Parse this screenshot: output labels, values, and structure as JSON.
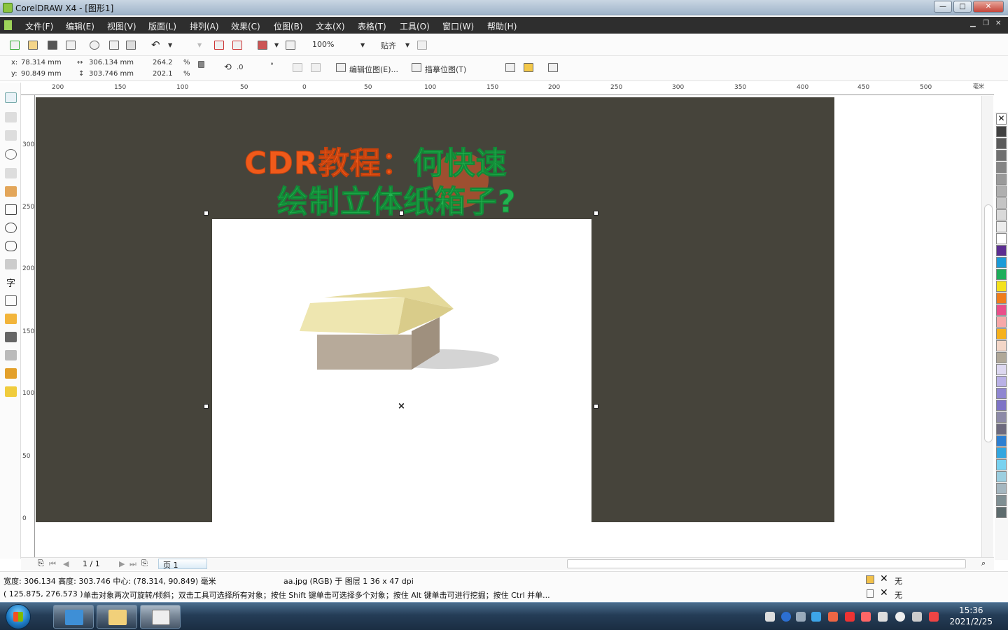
{
  "window": {
    "title": "CorelDRAW X4 - [图形1]",
    "min": "—",
    "max": "□",
    "close": "✕"
  },
  "menu": {
    "items": [
      "文件(F)",
      "编辑(E)",
      "视图(V)",
      "版面(L)",
      "排列(A)",
      "效果(C)",
      "位图(B)",
      "文本(X)",
      "表格(T)",
      "工具(O)",
      "窗口(W)",
      "帮助(H)"
    ]
  },
  "toolbar": {
    "zoom": "100%",
    "snap_label": "贴齐"
  },
  "propbar": {
    "x_label": "x:",
    "x_value": "78.314 mm",
    "y_label": "y:",
    "y_value": "90.849 mm",
    "w_value": "306.134 mm",
    "h_value": "303.746 mm",
    "scale_x": "264.2",
    "scale_y": "202.1",
    "pct": "%",
    "rotate": ".0",
    "degree": "°",
    "edit_bitmap": "编辑位图(E)...",
    "trace_bitmap": "描摹位图(T)"
  },
  "ruler": {
    "h_ticks": [
      "200",
      "150",
      "100",
      "50",
      "0",
      "50",
      "100",
      "150",
      "200",
      "250",
      "300",
      "350",
      "400",
      "450",
      "500"
    ],
    "v_ticks": [
      "300",
      "250",
      "200",
      "150",
      "100",
      "50",
      "0"
    ],
    "unit": "毫米"
  },
  "canvas": {
    "headline_line1_a": "CDR教程：",
    "headline_line1_b": "何快速",
    "headline_line2": "绘制立体纸箱子?",
    "center_mark": "×"
  },
  "pagenav": {
    "counter": "1 / 1",
    "tab": "页 1"
  },
  "status": {
    "dims": "宽度: 306.134 高度: 303.746 中心: (78.314, 90.849) 毫米",
    "object_info": "aa.jpg (RGB) 于 图层 1 36 x 47 dpi",
    "coords": "( 125.875, 276.573 )",
    "hint": "单击对象两次可旋转/倾斜；双击工具可选择所有对象；按住 Shift 键单击可选择多个对象；按住 Alt 键单击可进行挖掘；按住 Ctrl 并单...",
    "fill_label": "无",
    "outline_label": "无"
  },
  "palette": {
    "colors": [
      "#404040",
      "#5a5a5a",
      "#707070",
      "#858585",
      "#9a9a9a",
      "#afafaf",
      "#c4c4c4",
      "#d9d9d9",
      "#ececec",
      "#ffffff",
      "#5b2d91",
      "#1b9bd8",
      "#1fae5b",
      "#f4e21d",
      "#f07d1c",
      "#e94f8a",
      "#f7a8a8",
      "#f6b11d",
      "#f3d6c7",
      "#b0a898",
      "#ddd8f0",
      "#b9b1e6",
      "#8f86d1",
      "#7e74c6",
      "#8d8aa8",
      "#6d6a7e",
      "#2c7fd1",
      "#32a6df",
      "#79d2f0",
      "#9ccfe0",
      "#a5b7c0",
      "#7f8f93",
      "#5d6b6d"
    ]
  },
  "taskbar": {
    "time": "15:36",
    "date": "2021/2/25"
  }
}
